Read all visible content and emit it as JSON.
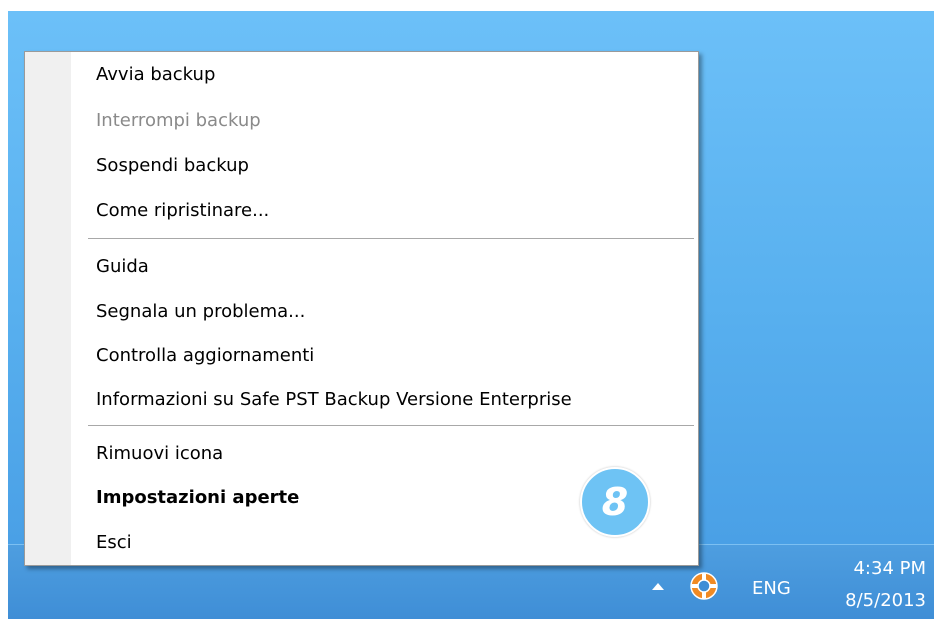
{
  "context_menu": {
    "items": [
      {
        "label": "Avvia backup",
        "state": "enabled"
      },
      {
        "label": "Interrompi backup",
        "state": "disabled"
      },
      {
        "label": "Sospendi backup",
        "state": "enabled"
      },
      {
        "label": "Come ripristinare...",
        "state": "enabled"
      },
      {
        "label": "Guida",
        "state": "enabled"
      },
      {
        "label": "Segnala un problema...",
        "state": "enabled"
      },
      {
        "label": "Controlla aggiornamenti",
        "state": "enabled"
      },
      {
        "label": "Informazioni su Safe PST Backup Versione Enterprise",
        "state": "enabled"
      },
      {
        "label": "Rimuovi icona",
        "state": "enabled"
      },
      {
        "label": "Impostazioni aperte",
        "state": "default"
      },
      {
        "label": "Esci",
        "state": "enabled"
      }
    ],
    "callout_number": "8",
    "callout_color": "#6ec3f4"
  },
  "taskbar": {
    "language": "ENG",
    "time": "4:34 PM",
    "date": "8/5/2013",
    "tray_icon": "lifebuoy-icon",
    "overflow_icon": "chevron-up-icon",
    "color": "#3f8ed6"
  },
  "desktop": {
    "color": "#5fb6f2"
  }
}
